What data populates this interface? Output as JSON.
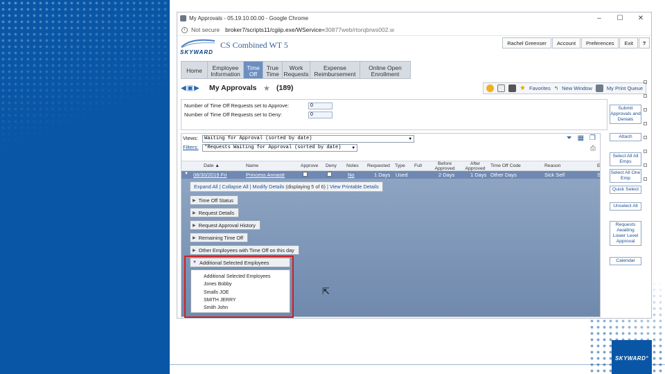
{
  "window": {
    "title": "My Approvals - 05.19.10.00.00 - Google Chrome",
    "minimize": "–",
    "maximize": "☐",
    "close": "✕"
  },
  "address": {
    "security": "Not secure",
    "host": "broker7/scripts11/cgiip.exe/WService=",
    "path": "30877web/rtorqbrws002.w"
  },
  "brand": {
    "logo_text": "SKYWARD",
    "product": "CS Combined WT 5",
    "slide_logo": "SKYWARD°"
  },
  "top_links": [
    "Rachel Greenser",
    "Account",
    "Preferences",
    "Exit",
    "?"
  ],
  "nav_tabs": [
    {
      "label": "Home",
      "active": false
    },
    {
      "label": "Employee Information",
      "active": false
    },
    {
      "label": "Time Off",
      "active": true
    },
    {
      "label": "True Time",
      "active": false
    },
    {
      "label": "Work Requests",
      "active": false
    },
    {
      "label": "Expense Reimbursement",
      "active": false
    },
    {
      "label": "Online Open Enrollment",
      "active": false
    }
  ],
  "page": {
    "title": "My Approvals",
    "count": "(189)"
  },
  "toolbar": {
    "favorites": "Favorites",
    "new_window": "New Window",
    "print_queue": "My Print Queue"
  },
  "counts": {
    "approve_label": "Number of Time Off Requests set to Approve:",
    "approve_value": "0",
    "deny_label": "Number of Time Off Requests set to Deny:",
    "deny_value": "0"
  },
  "grid": {
    "views_label": "Views:",
    "views_value": "Waiting for Approval (sorted by date)",
    "filters_label": "Filters:",
    "filters_value": "*Requests Waiting for Approval (sorted by date)",
    "columns": [
      "Date ▲",
      "Name",
      "Approve",
      "Deny",
      "Notes",
      "Requested",
      "Type",
      "Full",
      "Before Approved",
      "After Approved",
      "Time Off Code",
      "Reason",
      "E"
    ],
    "row": {
      "date": "08/30/2019 Fri",
      "name": "Princess Annastr",
      "notes": "No",
      "requested": "1 Days",
      "type": "Used",
      "before": "2 Days",
      "after": "1 Days",
      "code": "Other Days",
      "reason": "Sick Self",
      "e": "S"
    },
    "detail_links": [
      "Expand All",
      "Collapse All",
      "Modify Details",
      "(displaying 5 of 6)",
      "View Printable Details"
    ],
    "sections": [
      "Time Off Status",
      "Request Details",
      "Request Approval History",
      "Remaining Time Off",
      "Other Employees with Time Off on this day",
      "Additional Selected Employees"
    ],
    "additional_employees": [
      "Additional Selected Employees",
      "Jones Bobby",
      "Smalls JOE",
      "SMITH JERRY",
      "Smith John"
    ]
  },
  "side_buttons": [
    "Submit Approvals and Denials",
    "Attach",
    "Select All All Emps",
    "Select All One Emp",
    "Quick Select",
    "Unselect All",
    "Requests Awaiting Lower Level Approval",
    "Calendar"
  ],
  "colors": {
    "slide_blue": "#0a56a6",
    "active_tab": "#6c8fc0",
    "selected_row": "#7089b3",
    "highlight": "#d11f1f"
  }
}
